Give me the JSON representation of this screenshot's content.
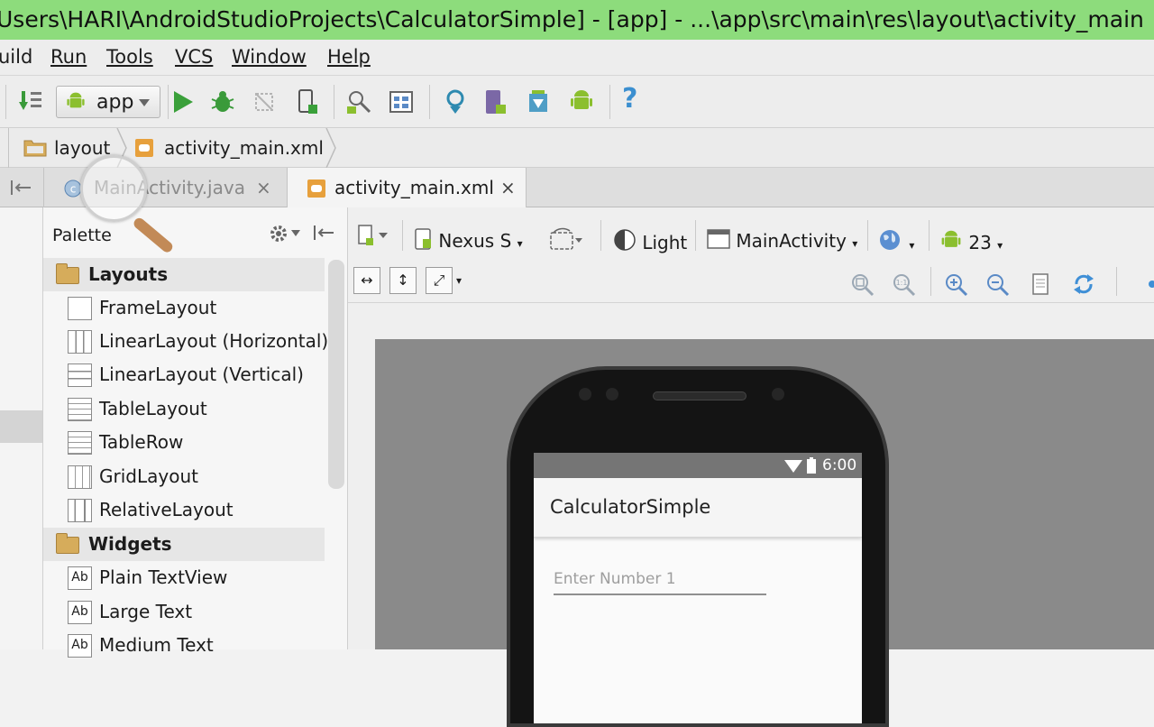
{
  "window": {
    "title": "Users\\HARI\\AndroidStudioProjects\\CalculatorSimple] - [app] - ...\\app\\src\\main\\res\\layout\\activity_main"
  },
  "menu": [
    "uild",
    "Run",
    "Tools",
    "VCS",
    "Window",
    "Help"
  ],
  "toolbar": {
    "run_config": "app",
    "help_glyph": "?"
  },
  "breadcrumb": [
    "layout",
    "activity_main.xml"
  ],
  "tabs": [
    {
      "label": "MainActivity.java",
      "close": "×"
    },
    {
      "label": "activity_main.xml",
      "close": "×"
    }
  ],
  "palette": {
    "title": "Palette",
    "groups": [
      {
        "label": "Layouts",
        "items": [
          {
            "label": "FrameLayout",
            "icon": ""
          },
          {
            "label": "LinearLayout (Horizontal)",
            "icon": ""
          },
          {
            "label": "LinearLayout (Vertical)",
            "icon": ""
          },
          {
            "label": "TableLayout",
            "icon": ""
          },
          {
            "label": "TableRow",
            "icon": ""
          },
          {
            "label": "GridLayout",
            "icon": ""
          },
          {
            "label": "RelativeLayout",
            "icon": ""
          }
        ]
      },
      {
        "label": "Widgets",
        "items": [
          {
            "label": "Plain TextView",
            "icon": "Ab"
          },
          {
            "label": "Large Text",
            "icon": "Ab"
          },
          {
            "label": "Medium Text",
            "icon": "Ab"
          }
        ]
      }
    ]
  },
  "designer": {
    "device": "Nexus S",
    "theme": "Light",
    "activity": "MainActivity",
    "api_level": "23",
    "preview": {
      "status_time": "6:00",
      "app_title": "CalculatorSimple",
      "edit_hint": "Enter Number 1"
    }
  },
  "colors": {
    "title_bar": "#8ddc7c",
    "android_green": "#8bbf2e",
    "run_green": "#3aa03a"
  }
}
